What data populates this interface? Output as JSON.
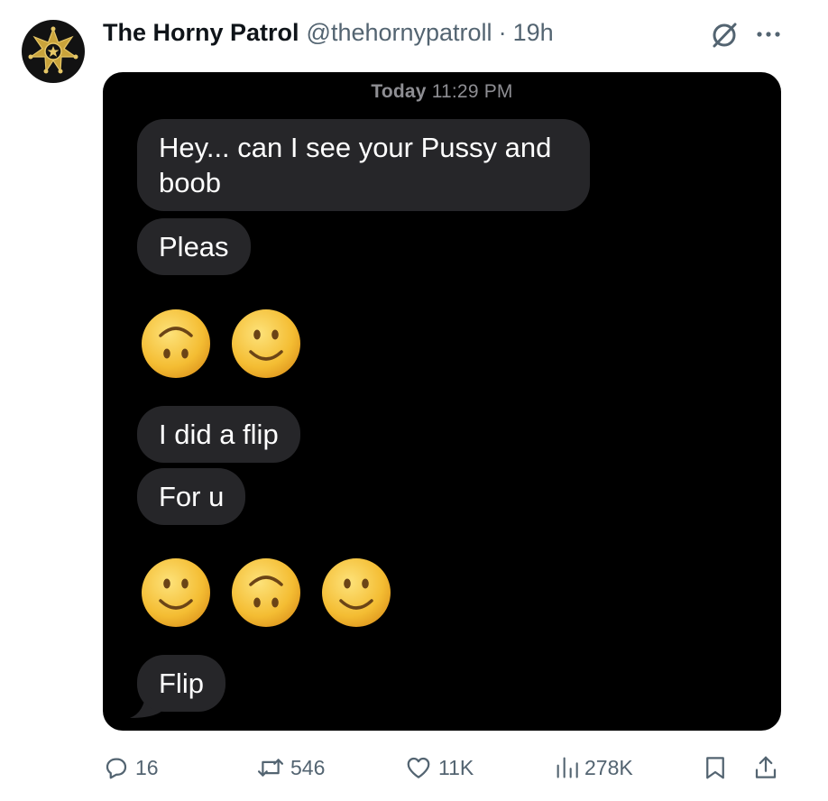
{
  "tweet": {
    "author_name": "The Horny Patrol",
    "author_handle": "@thehornypatroll",
    "separator": "·",
    "timestamp": "19h"
  },
  "icons": {
    "avatar": "sheriff-star-badge-icon",
    "grok": "grok-icon",
    "more": "more-dots-icon",
    "reply": "reply-bubble-icon",
    "retweet": "retweet-icon",
    "like": "heart-icon",
    "views": "views-bar-chart-icon",
    "bookmark": "bookmark-icon",
    "share": "share-icon"
  },
  "chat": {
    "day_label": "Today",
    "time_label": "11:29 PM",
    "messages": [
      "Hey... can I see your Pussy and boob",
      "Pleas",
      "I did a flip",
      "For u",
      "Flip"
    ],
    "emoji_rows": [
      [
        "upside-down-face",
        "slightly-smiling-face"
      ],
      [
        "slightly-smiling-face",
        "upside-down-face",
        "slightly-smiling-face"
      ]
    ]
  },
  "stats": {
    "replies": "16",
    "retweets": "546",
    "likes": "11K",
    "views": "278K"
  },
  "colors": {
    "text_primary": "#0f1419",
    "text_secondary": "#536471",
    "chat_background": "#000000",
    "bubble": "#262629",
    "emoji_yellow": "#f7c531"
  }
}
